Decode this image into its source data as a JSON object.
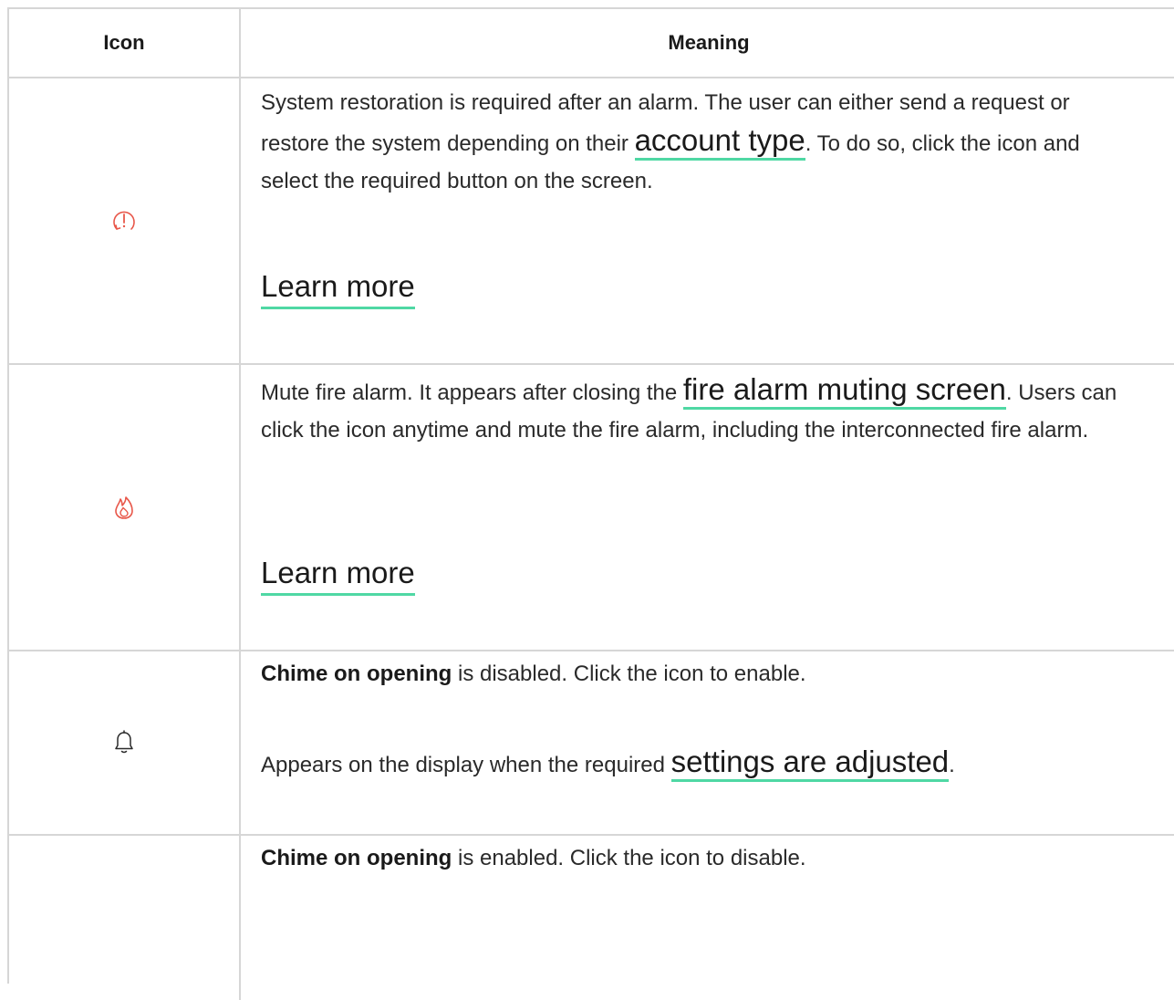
{
  "header": {
    "icon_col": "Icon",
    "meaning_col": "Meaning"
  },
  "rows": [
    {
      "icon": "restore-alert-icon",
      "text_before": "System restoration is required after an alarm. The user can either send a request or restore the system depending on their ",
      "link": "account type",
      "text_after": ". To do so, click the icon and select the required button on the screen.",
      "learn_more": "Learn more"
    },
    {
      "icon": "fire-icon",
      "text_before": "Mute fire alarm. It appears after closing the ",
      "link": "fire alarm muting screen",
      "text_after": ". Users can click the icon anytime and mute the fire alarm, including the interconnected fire alarm.",
      "learn_more": "Learn more"
    },
    {
      "icon": "bell-icon",
      "bold": "Chime on opening",
      "text": " is disabled. Click the icon to enable.",
      "text2_before": "Appears on the display when the required ",
      "link": "settings are adjusted",
      "text2_after": "."
    },
    {
      "icon": "bell-enabled-icon",
      "bold": "Chime on opening",
      "text": " is enabled. Click the icon to disable."
    }
  ],
  "colors": {
    "accent_underline": "#4fd8a4",
    "alert_icon": "#e8574a",
    "border": "#d6d6d6"
  }
}
